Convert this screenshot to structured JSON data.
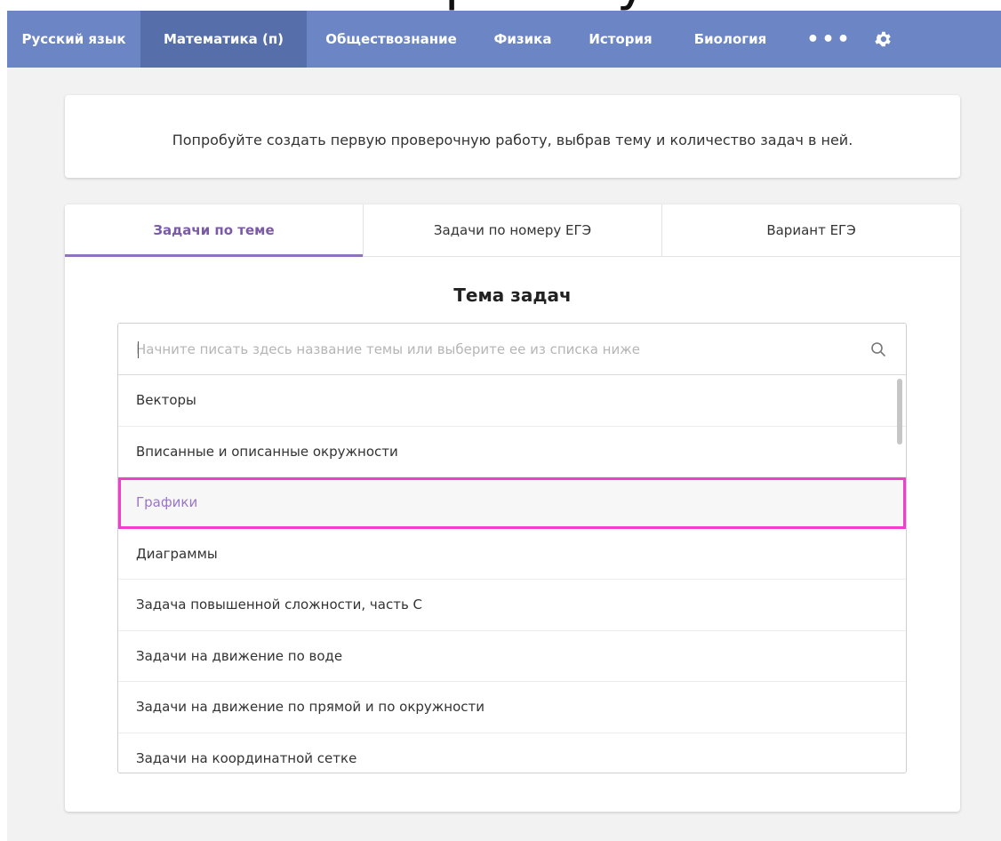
{
  "top_title": "работу",
  "nav": {
    "items": [
      {
        "label": "Русский язык"
      },
      {
        "label": "Математика (п)"
      },
      {
        "label": "Обществознание"
      },
      {
        "label": "Физика"
      },
      {
        "label": "История"
      },
      {
        "label": "Биология"
      }
    ],
    "more_label": "•••",
    "active_index": 1
  },
  "info": {
    "text": "Попробуйте создать первую проверочную работу, выбрав тему и количество задач в ней."
  },
  "tabs": [
    {
      "label": "Задачи по теме"
    },
    {
      "label": "Задачи по номеру ЕГЭ"
    },
    {
      "label": "Вариант ЕГЭ"
    }
  ],
  "section": {
    "title": "Тема задач"
  },
  "search": {
    "placeholder": "Начните писать здесь название темы или выберите ее из списка ниже",
    "value": ""
  },
  "topics": [
    "Векторы",
    "Вписанные и описанные окружности",
    "Графики",
    "Диаграммы",
    "Задача повышенной сложности, часть С",
    "Задачи на движение по воде",
    "Задачи на движение по прямой и по окружности",
    "Задачи на координатной сетке"
  ],
  "colors": {
    "nav_bg": "#6b85c5",
    "nav_active": "#566fab",
    "accent": "#8f73bf",
    "highlight_border": "#f23ecb"
  }
}
